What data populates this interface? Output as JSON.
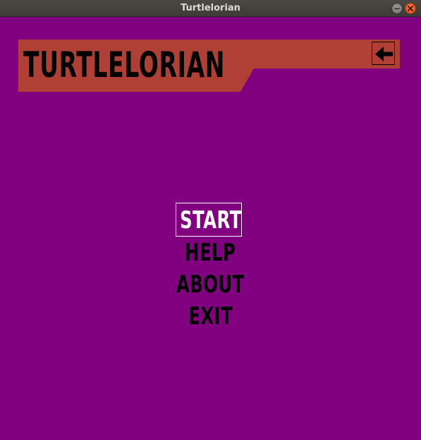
{
  "window": {
    "title": "Turtlelorian"
  },
  "game": {
    "title": "TURTLELORIAN",
    "colors": {
      "background": "#800080",
      "banner": "#b04035",
      "text": "#000000",
      "selected_text": "#ffffff"
    },
    "back_button_icon": "left-arrow-icon",
    "menu": {
      "selected_index": 0,
      "items": [
        {
          "label": "START"
        },
        {
          "label": "HELP"
        },
        {
          "label": "ABOUT"
        },
        {
          "label": "EXIT"
        }
      ]
    }
  }
}
